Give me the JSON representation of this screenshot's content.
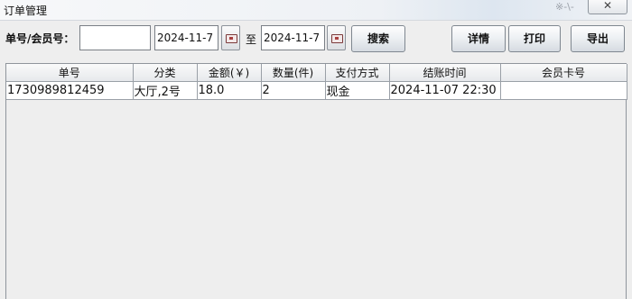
{
  "window": {
    "title": "订单管理",
    "title_ghost": "※-\\-"
  },
  "toolbar": {
    "search_label": "单号/会员号：",
    "search_value": "",
    "date_from": "2024-11-7",
    "to_label": "至",
    "date_to": "2024-11-7",
    "search_button": "搜索",
    "detail_button": "详情",
    "print_button": "打印",
    "export_button": "导出"
  },
  "table": {
    "columns": [
      "单号",
      "分类",
      "金额(￥)",
      "数量(件)",
      "支付方式",
      "结账时间",
      "会员卡号"
    ],
    "rows": [
      [
        "1730989812459",
        "大厅,2号",
        "18.0",
        "2",
        "现金",
        "2024-11-07 22:30",
        ""
      ]
    ]
  }
}
